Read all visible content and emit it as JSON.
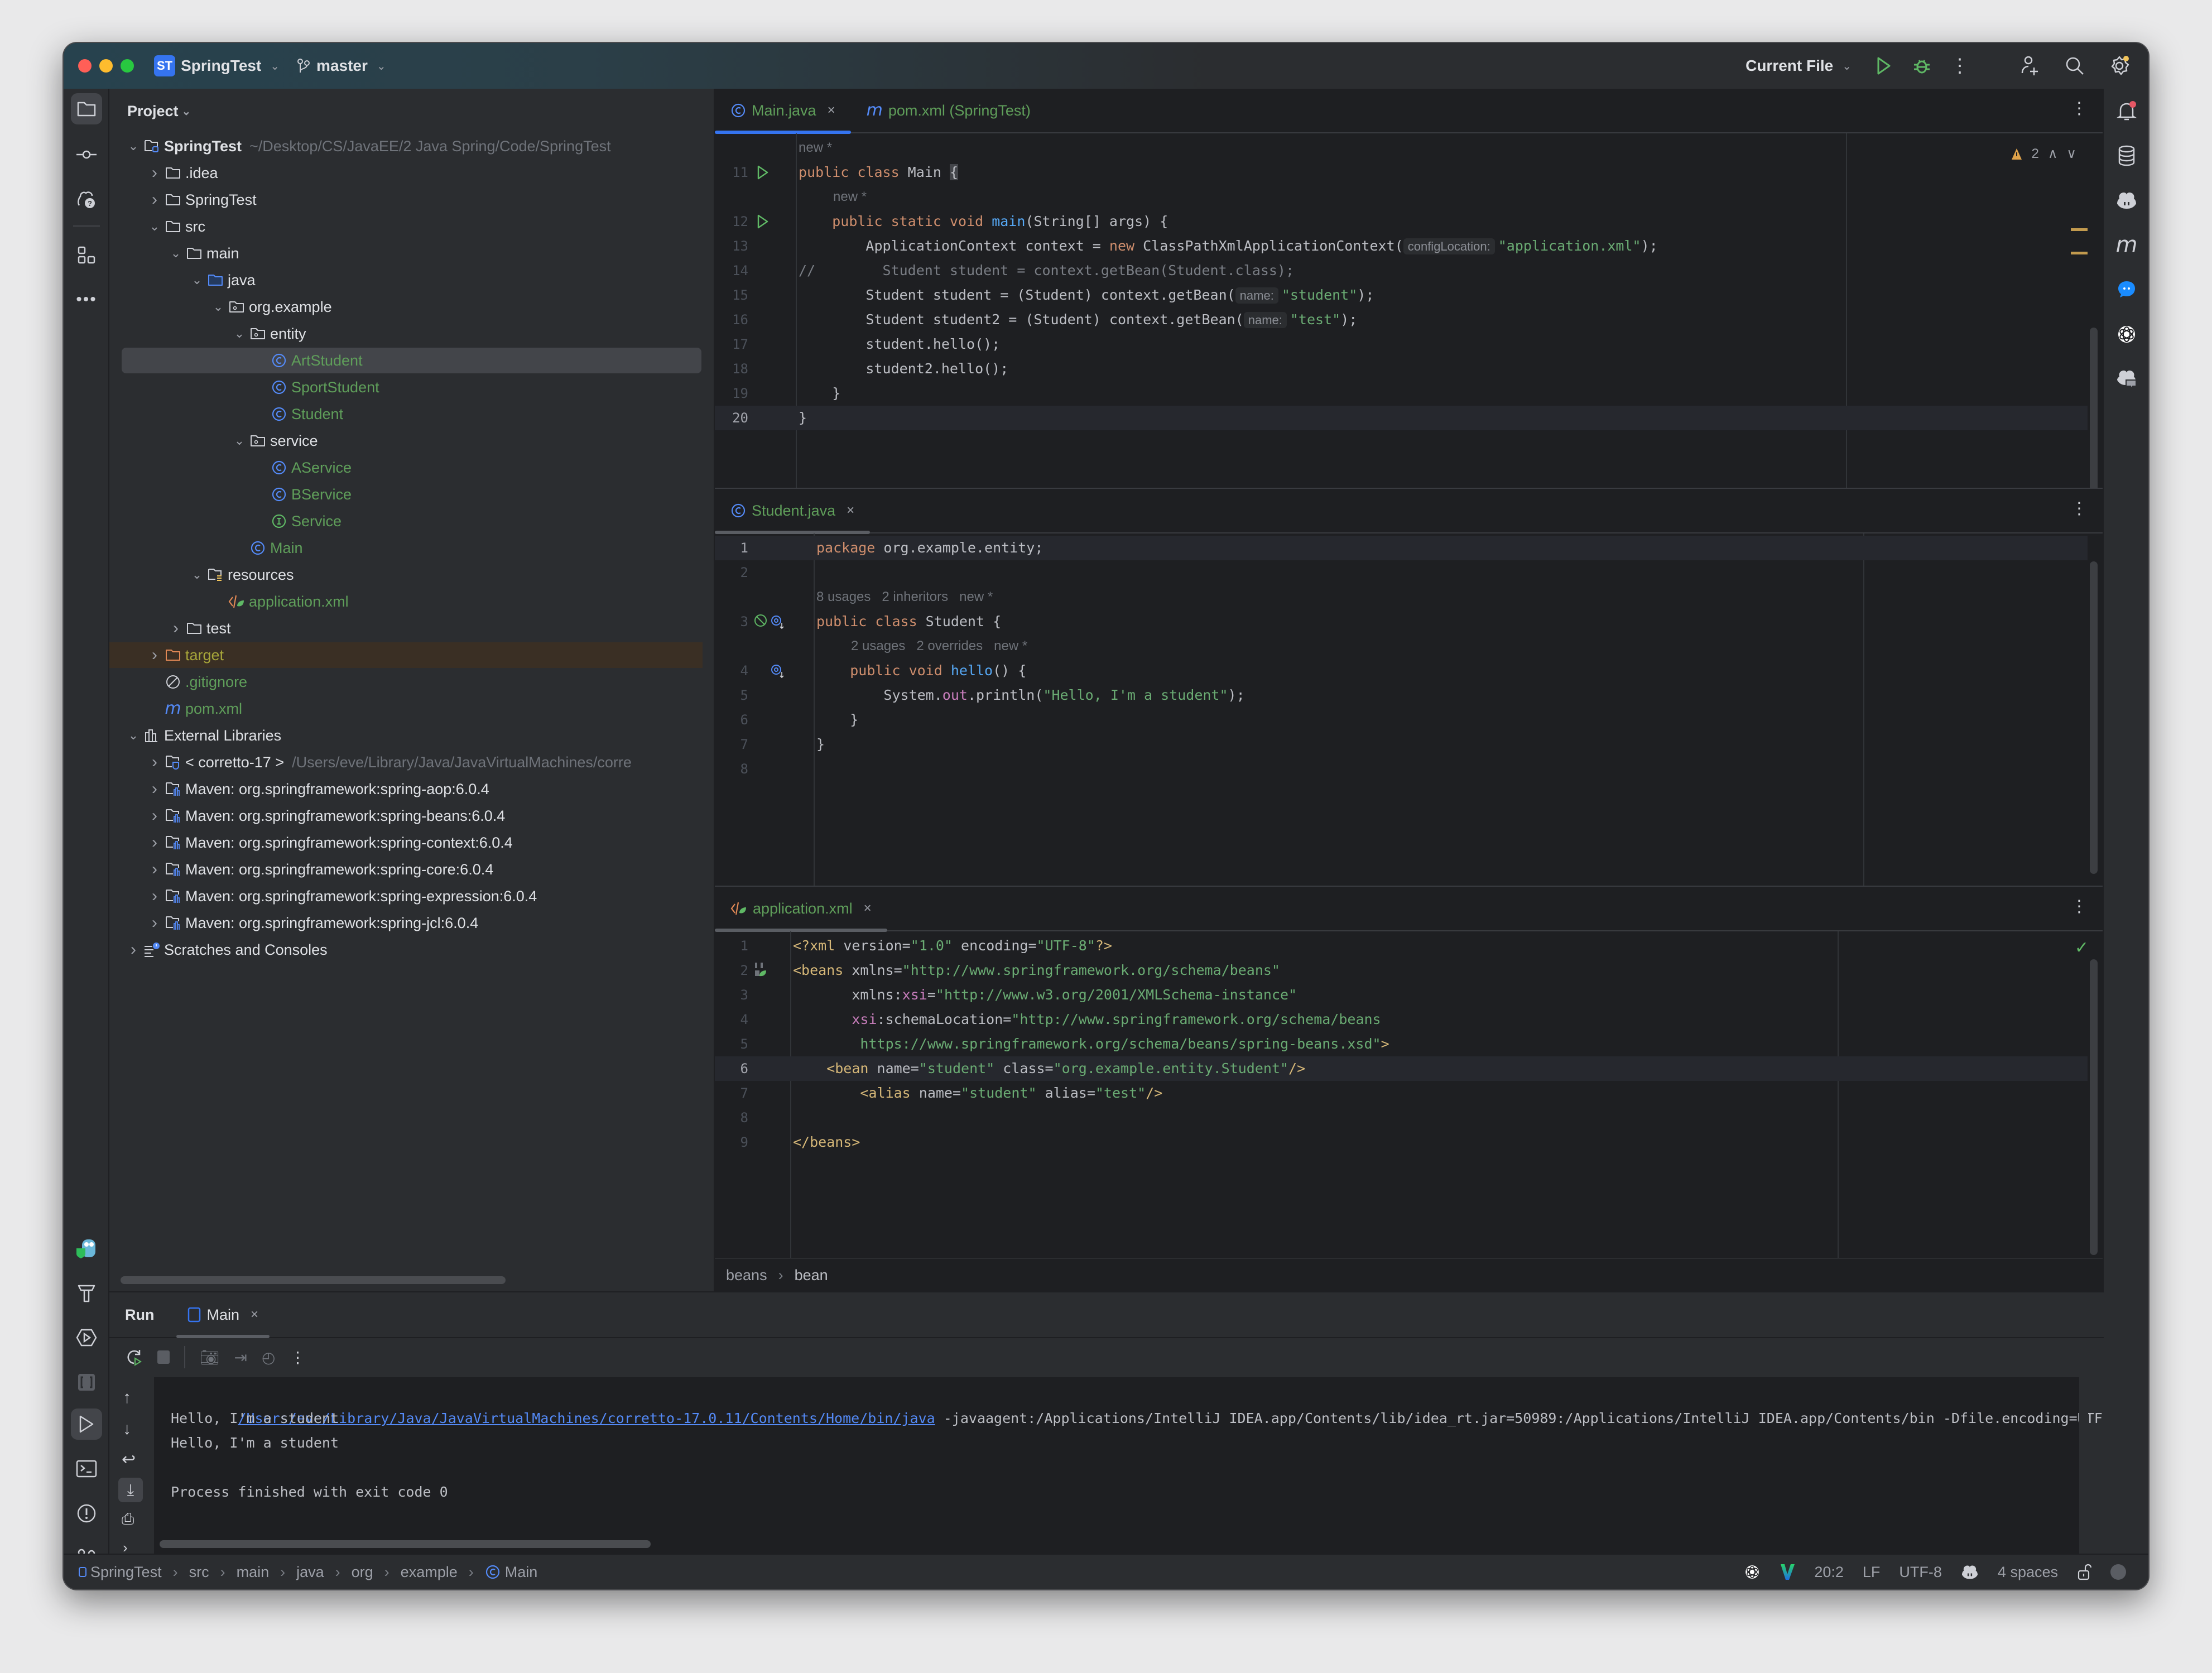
{
  "titlebar": {
    "project_badge": "ST",
    "project_name": "SpringTest",
    "branch": "master",
    "run_config": "Current File",
    "icons": [
      "run-icon",
      "debug-icon",
      "more-icon",
      "add-user-icon",
      "search-icon",
      "settings-icon"
    ]
  },
  "left_toolbar": {
    "top_icons": [
      "folder-icon",
      "commit-icon",
      "ai-help-icon",
      "structure-icon",
      "more-icon"
    ],
    "bottom_icons": [
      "gopher-plugin-icon",
      "build-hammer-icon",
      "services-icon",
      "debug-bracket-icon",
      "run-icon",
      "terminal-icon",
      "problems-icon",
      "git-icon"
    ]
  },
  "right_toolbar": {
    "icons": [
      "notifications-icon",
      "database-icon",
      "copilot-icon",
      "maven-icon",
      "chat-icon",
      "openai-icon",
      "copilot-chat-icon"
    ]
  },
  "project_panel": {
    "title": "Project",
    "tree": [
      {
        "label": "SpringTest",
        "hint": "~/Desktop/CS/JavaEE/2 Java Spring/Code/SpringTest",
        "depth": 0,
        "expanded": true,
        "icon": "module-folder-icon",
        "bold": true
      },
      {
        "label": ".idea",
        "depth": 1,
        "expanded": false,
        "icon": "folder-icon"
      },
      {
        "label": "SpringTest",
        "depth": 1,
        "expanded": false,
        "icon": "folder-icon"
      },
      {
        "label": "src",
        "depth": 1,
        "expanded": true,
        "icon": "folder-icon"
      },
      {
        "label": "main",
        "depth": 2,
        "expanded": true,
        "icon": "folder-icon"
      },
      {
        "label": "java",
        "depth": 3,
        "expanded": true,
        "icon": "source-folder-icon"
      },
      {
        "label": "org.example",
        "depth": 4,
        "expanded": true,
        "icon": "package-icon"
      },
      {
        "label": "entity",
        "depth": 5,
        "expanded": true,
        "icon": "package-icon"
      },
      {
        "label": "ArtStudent",
        "depth": 6,
        "icon": "class-icon",
        "color": "green",
        "selected": true
      },
      {
        "label": "SportStudent",
        "depth": 6,
        "icon": "class-icon",
        "color": "green"
      },
      {
        "label": "Student",
        "depth": 6,
        "icon": "class-icon",
        "color": "green"
      },
      {
        "label": "service",
        "depth": 5,
        "expanded": true,
        "icon": "package-icon"
      },
      {
        "label": "AService",
        "depth": 6,
        "icon": "class-icon",
        "color": "green"
      },
      {
        "label": "BService",
        "depth": 6,
        "icon": "class-icon",
        "color": "green"
      },
      {
        "label": "Service",
        "depth": 6,
        "icon": "interface-icon",
        "color": "green"
      },
      {
        "label": "Main",
        "depth": 5,
        "icon": "class-icon",
        "color": "green"
      },
      {
        "label": "resources",
        "depth": 3,
        "expanded": true,
        "icon": "resources-folder-icon"
      },
      {
        "label": "application.xml",
        "depth": 4,
        "icon": "spring-xml-icon",
        "color": "green"
      },
      {
        "label": "test",
        "depth": 2,
        "expanded": false,
        "icon": "folder-icon"
      },
      {
        "label": "target",
        "depth": 1,
        "expanded": false,
        "icon": "excluded-folder-icon",
        "color": "olive",
        "excluded": true
      },
      {
        "label": ".gitignore",
        "depth": 1,
        "icon": "ignore-file-icon",
        "color": "green"
      },
      {
        "label": "pom.xml",
        "depth": 1,
        "icon": "maven-file-icon",
        "color": "green"
      },
      {
        "label": "External Libraries",
        "depth": 0,
        "expanded": true,
        "icon": "library-icon"
      },
      {
        "label": "< corretto-17 >",
        "hint": "/Users/eve/Library/Java/JavaVirtualMachines/corre",
        "depth": 1,
        "expanded": false,
        "icon": "jdk-icon"
      },
      {
        "label": "Maven: org.springframework:spring-aop:6.0.4",
        "depth": 1,
        "expanded": false,
        "icon": "library-folder-icon"
      },
      {
        "label": "Maven: org.springframework:spring-beans:6.0.4",
        "depth": 1,
        "expanded": false,
        "icon": "library-folder-icon"
      },
      {
        "label": "Maven: org.springframework:spring-context:6.0.4",
        "depth": 1,
        "expanded": false,
        "icon": "library-folder-icon"
      },
      {
        "label": "Maven: org.springframework:spring-core:6.0.4",
        "depth": 1,
        "expanded": false,
        "icon": "library-folder-icon"
      },
      {
        "label": "Maven: org.springframework:spring-expression:6.0.4",
        "depth": 1,
        "expanded": false,
        "icon": "library-folder-icon"
      },
      {
        "label": "Maven: org.springframework:spring-jcl:6.0.4",
        "depth": 1,
        "expanded": false,
        "icon": "library-folder-icon"
      },
      {
        "label": "Scratches and Consoles",
        "depth": 0,
        "expanded": false,
        "icon": "scratches-icon"
      }
    ]
  },
  "editor_main": {
    "tabs": [
      {
        "label": "Main.java",
        "icon": "class-icon",
        "active": true,
        "closable": true
      },
      {
        "label": "pom.xml (SpringTest)",
        "icon": "maven-file-icon",
        "active": false,
        "italic": true
      }
    ],
    "warnings": {
      "count": "2"
    },
    "lines": [
      {
        "hint": "new *"
      },
      {
        "n": "11",
        "run": true,
        "tokens": [
          [
            "kw",
            "public class "
          ],
          [
            "",
            "Main "
          ],
          [
            "brace",
            "{"
          ]
        ]
      },
      {
        "hint": "new *",
        "indent": 1
      },
      {
        "n": "12",
        "run": true,
        "tokens": [
          [
            "",
            "    "
          ],
          [
            "kw",
            "public static void "
          ],
          [
            "fn",
            "main"
          ],
          [
            "",
            "(String[] args) {"
          ]
        ]
      },
      {
        "n": "13",
        "tokens": [
          [
            "",
            "        ApplicationContext context = "
          ],
          [
            "kw",
            "new "
          ],
          [
            "",
            "ClassPathXmlApplicationContext("
          ],
          [
            "inlay",
            "configLocation:"
          ],
          [
            "str",
            "\"application.xml\""
          ],
          [
            "",
            ");"
          ]
        ]
      },
      {
        "n": "14",
        "tokens": [
          [
            "cm",
            "//        Student student = context.getBean(Student.class);"
          ]
        ]
      },
      {
        "n": "15",
        "tokens": [
          [
            "",
            "        Student student = (Student) context.getBean("
          ],
          [
            "inlay",
            "name:"
          ],
          [
            "str",
            "\"student\""
          ],
          [
            "",
            ");"
          ]
        ]
      },
      {
        "n": "16",
        "tokens": [
          [
            "",
            "        Student student2 = (Student) context.getBean("
          ],
          [
            "inlay",
            "name:"
          ],
          [
            "str",
            "\"test\""
          ],
          [
            "",
            ");"
          ]
        ]
      },
      {
        "n": "17",
        "tokens": [
          [
            "",
            "        student.hello();"
          ]
        ]
      },
      {
        "n": "18",
        "tokens": [
          [
            "",
            "        student2.hello();"
          ]
        ]
      },
      {
        "n": "19",
        "tokens": [
          [
            "",
            "    }"
          ]
        ]
      },
      {
        "n": "20",
        "current": true,
        "tokens": [
          [
            "",
            "}"
          ]
        ]
      }
    ]
  },
  "editor_student": {
    "tabs": [
      {
        "label": "Student.java",
        "icon": "class-icon",
        "closable": true
      }
    ],
    "lines": [
      {
        "n": "1",
        "current": true,
        "tokens": [
          [
            "kw",
            "package "
          ],
          [
            "",
            "org.example.entity;"
          ]
        ]
      },
      {
        "n": "2",
        "tokens": []
      },
      {
        "hint": "8 usages   2 inheritors   new *"
      },
      {
        "n": "3",
        "tokens": [
          [
            "kw",
            "public class "
          ],
          [
            "",
            "Student {"
          ]
        ]
      },
      {
        "hint": "2 usages   2 overrides   new *",
        "indent": 1
      },
      {
        "n": "4",
        "tokens": [
          [
            "",
            "    "
          ],
          [
            "kw",
            "public void "
          ],
          [
            "fn",
            "hello"
          ],
          [
            "",
            "() {"
          ]
        ]
      },
      {
        "n": "5",
        "tokens": [
          [
            "",
            "        System."
          ],
          [
            "pur",
            "out"
          ],
          [
            "",
            ".println("
          ],
          [
            "str",
            "\"Hello, I'm a student\""
          ],
          [
            "",
            ");"
          ]
        ]
      },
      {
        "n": "6",
        "tokens": [
          [
            "",
            "    }"
          ]
        ]
      },
      {
        "n": "7",
        "tokens": [
          [
            "",
            "}"
          ]
        ]
      },
      {
        "n": "8",
        "tokens": []
      }
    ]
  },
  "editor_xml": {
    "tabs": [
      {
        "label": "application.xml",
        "icon": "spring-xml-icon",
        "closable": true
      }
    ],
    "lines": [
      {
        "n": "1",
        "tokens": [
          [
            "tag",
            "<?xml "
          ],
          [
            "attr",
            "version="
          ],
          [
            "str",
            "\"1.0\" "
          ],
          [
            "attr",
            "encoding="
          ],
          [
            "str",
            "\"UTF-8\""
          ],
          [
            "tag",
            "?>"
          ]
        ]
      },
      {
        "n": "2",
        "tokens": [
          [
            "tag",
            "<beans "
          ],
          [
            "attr",
            "xmlns="
          ],
          [
            "str",
            "\"http://www.springframework.org/schema/beans\""
          ]
        ]
      },
      {
        "n": "3",
        "tokens": [
          [
            "attr",
            "       xmlns:"
          ],
          [
            "pur",
            "xsi"
          ],
          [
            "attr",
            "="
          ],
          [
            "str",
            "\"http://www.w3.org/2001/XMLSchema-instance\""
          ]
        ]
      },
      {
        "n": "4",
        "tokens": [
          [
            "pur",
            "       xsi"
          ],
          [
            "attr",
            ":schemaLocation="
          ],
          [
            "str",
            "\"http://www.springframework.org/schema/beans"
          ]
        ]
      },
      {
        "n": "5",
        "tokens": [
          [
            "str",
            "        https://www.springframework.org/schema/beans/spring-beans.xsd\""
          ],
          [
            "tag",
            ">"
          ]
        ]
      },
      {
        "n": "6",
        "current": true,
        "tokens": [
          [
            "tag",
            "    <bean "
          ],
          [
            "attr",
            "name="
          ],
          [
            "str",
            "\"student\" "
          ],
          [
            "attr",
            "class="
          ],
          [
            "str",
            "\"org.example.entity.Student\""
          ],
          [
            "tag",
            "/>"
          ]
        ]
      },
      {
        "n": "7",
        "tokens": [
          [
            "tag",
            "        <alias "
          ],
          [
            "attr",
            "name="
          ],
          [
            "str",
            "\"student\" "
          ],
          [
            "attr",
            "alias="
          ],
          [
            "str",
            "\"test\""
          ],
          [
            "tag",
            "/>"
          ]
        ]
      },
      {
        "n": "8",
        "tokens": []
      },
      {
        "n": "9",
        "tokens": [
          [
            "tag",
            "</beans>"
          ]
        ]
      }
    ],
    "breadcrumb": [
      "beans",
      "bean"
    ]
  },
  "run_panel": {
    "title": "Run",
    "tab": "Main",
    "console": {
      "command_link": "/Users/eve/Library/Java/JavaVirtualMachines/corretto-17.0.11/Contents/Home/bin/java",
      "command_rest": " -javaagent:/Applications/IntelliJ IDEA.app/Contents/lib/idea_rt.jar=50989:/Applications/IntelliJ IDEA.app/Contents/bin -Dfile.encoding=UTF",
      "output": [
        "Hello, I'm a student",
        "Hello, I'm a student",
        "",
        "Process finished with exit code 0"
      ]
    }
  },
  "status_bar": {
    "breadcrumb": [
      "SpringTest",
      "src",
      "main",
      "java",
      "org",
      "example",
      "Main"
    ],
    "position": "20:2",
    "line_separator": "LF",
    "encoding": "UTF-8",
    "indent": "4 spaces"
  },
  "colors": {
    "accent": "#3574f0",
    "keyword": "#cf8e6d",
    "string": "#6aab73",
    "function": "#56a8f5",
    "tag": "#d5b778",
    "green_file": "#5f9e5a",
    "warning": "#e0a34a",
    "run_green": "#5fb865"
  }
}
